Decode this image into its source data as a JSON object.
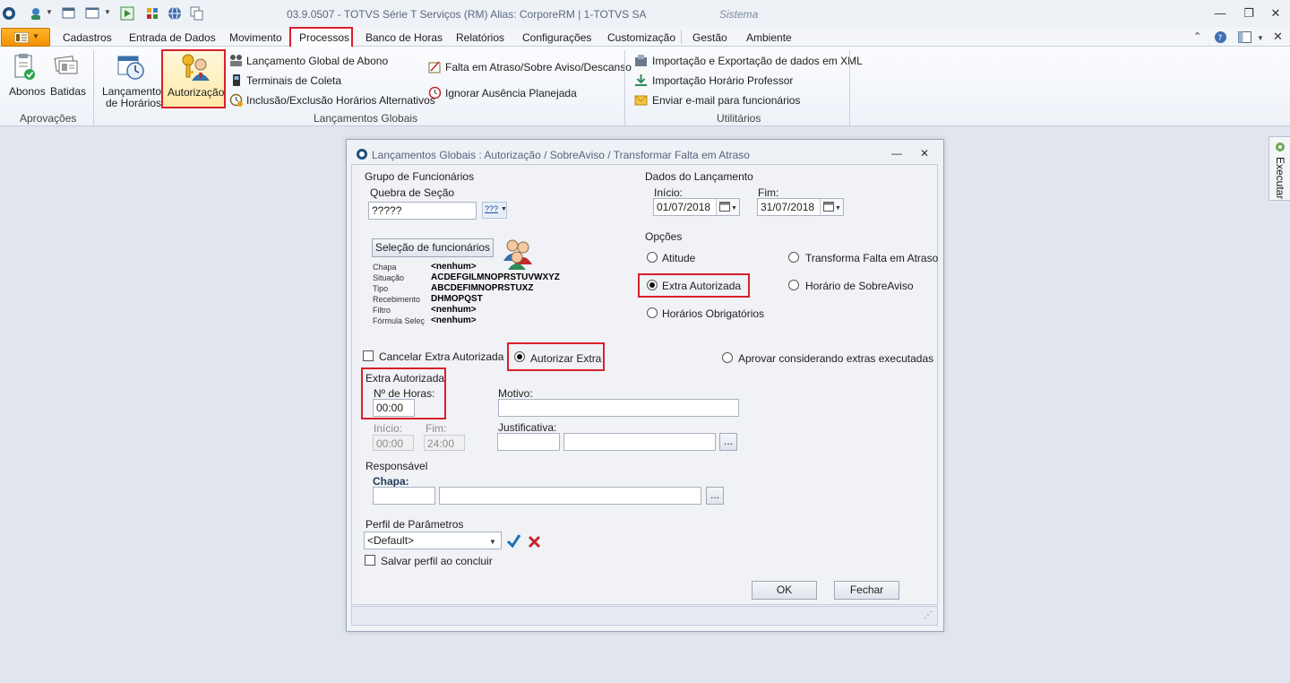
{
  "titlebar": {
    "title": "03.9.0507 - TOTVS Série T Serviços (RM) Alias: CorporeRM | 1-TOTVS SA",
    "app_name": "Sistema"
  },
  "menu": {
    "items": [
      "Cadastros",
      "Entrada de Dados",
      "Movimento",
      "Processos",
      "Banco de Horas",
      "Relatórios",
      "Configurações",
      "Customização",
      "Gestão",
      "Ambiente"
    ]
  },
  "ribbon": {
    "aprovacoes": {
      "label": "Aprovações",
      "abonos": "Abonos",
      "batidas": "Batidas"
    },
    "lancamentos": {
      "label": "Lançamentos Globais",
      "lancamento_horarios_1": "Lançamento",
      "lancamento_horarios_2": "de Horários",
      "autorizacao": "Autorização",
      "global_abono": "Lançamento Global de Abono",
      "terminais": "Terminais de Coleta",
      "inclusao": "Inclusão/Exclusão Horários Alternativos",
      "falta_atraso": "Falta em Atraso/Sobre Aviso/Descanso",
      "ignorar": "Ignorar Ausência Planejada"
    },
    "utilitarios": {
      "label": "Utilitários",
      "importacao_xml": "Importação e Exportação de dados em XML",
      "importacao_professor": "Importação Horário Professor",
      "enviar_email": "Enviar e-mail para funcionários"
    }
  },
  "sidetab": {
    "label": "Executar"
  },
  "dialog": {
    "title": "Lançamentos Globais : Autorização / SobreAviso / Transformar Falta em Atraso",
    "grupo": {
      "title": "Grupo de Funcionários",
      "quebra_label": "Quebra de Seção",
      "quebra_value": "?????",
      "selector_label": "???",
      "selecao_button": "Seleção de funcionários",
      "info": [
        {
          "key": "Chapa",
          "value": "<nenhum>"
        },
        {
          "key": "Situação",
          "value": "ACDEFGILMNOPRSTUVWXYZ"
        },
        {
          "key": "Tipo",
          "value": "ABCDEFIMNOPRSTUXZ"
        },
        {
          "key": "Recebimento",
          "value": "DHMOPQST"
        },
        {
          "key": "Filtro",
          "value": "<nenhum>"
        },
        {
          "key": "Fórmula Seleç",
          "value": "<nenhum>"
        }
      ]
    },
    "dados": {
      "title": "Dados do Lançamento",
      "inicio_label": "Início:",
      "inicio_value": "01/07/2018",
      "fim_label": "Fim:",
      "fim_value": "31/07/2018"
    },
    "opcoes": {
      "title": "Opções",
      "atitude": "Atitude",
      "transforma": "Transforma Falta em Atraso",
      "extra_autorizada": "Extra Autorizada",
      "horario_sobreaviso": "Horário de SobreAviso",
      "horarios_obrigatorios": "Horários Obrigatórios",
      "selected": "extra_autorizada"
    },
    "acoes": {
      "cancelar": "Cancelar Extra Autorizada",
      "autorizar": "Autorizar Extra",
      "aprovar": "Aprovar considerando extras executadas",
      "selected": "autorizar"
    },
    "extra": {
      "title": "Extra Autorizada",
      "horas_label": "Nº de Horas:",
      "horas_value": "00:00",
      "inicio_label": "Início:",
      "inicio_value": "00:00",
      "fim_label": "Fim:",
      "fim_value": "24:00",
      "motivo_label": "Motivo:",
      "justificativa_label": "Justificativa:",
      "lookup": "..."
    },
    "responsavel": {
      "title": "Responsável",
      "chapa_label": "Chapa:",
      "lookup": "..."
    },
    "perfil": {
      "title": "Perfil de Parâmetros",
      "value": "<Default>",
      "salvar": "Salvar perfil ao concluir"
    },
    "buttons": {
      "ok": "OK",
      "fechar": "Fechar"
    }
  },
  "colors": {
    "highlight": "#d8202a",
    "accent": "#f19000",
    "check": "#1f6fb8",
    "cross": "#c0282d"
  }
}
